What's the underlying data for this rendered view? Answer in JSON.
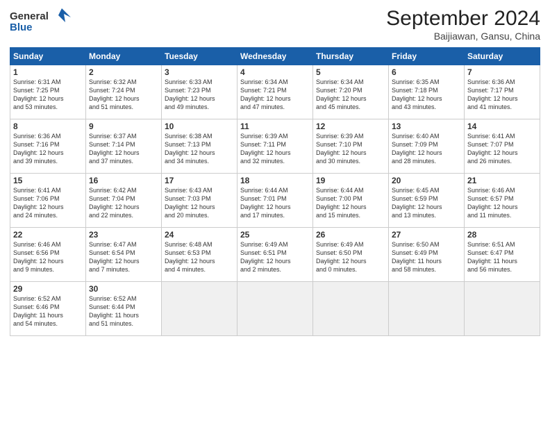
{
  "header": {
    "logo_general": "General",
    "logo_blue": "Blue",
    "month_title": "September 2024",
    "location": "Baijiawan, Gansu, China"
  },
  "weekdays": [
    "Sunday",
    "Monday",
    "Tuesday",
    "Wednesday",
    "Thursday",
    "Friday",
    "Saturday"
  ],
  "weeks": [
    [
      {
        "day": "1",
        "detail": "Sunrise: 6:31 AM\nSunset: 7:25 PM\nDaylight: 12 hours\nand 53 minutes."
      },
      {
        "day": "2",
        "detail": "Sunrise: 6:32 AM\nSunset: 7:24 PM\nDaylight: 12 hours\nand 51 minutes."
      },
      {
        "day": "3",
        "detail": "Sunrise: 6:33 AM\nSunset: 7:23 PM\nDaylight: 12 hours\nand 49 minutes."
      },
      {
        "day": "4",
        "detail": "Sunrise: 6:34 AM\nSunset: 7:21 PM\nDaylight: 12 hours\nand 47 minutes."
      },
      {
        "day": "5",
        "detail": "Sunrise: 6:34 AM\nSunset: 7:20 PM\nDaylight: 12 hours\nand 45 minutes."
      },
      {
        "day": "6",
        "detail": "Sunrise: 6:35 AM\nSunset: 7:18 PM\nDaylight: 12 hours\nand 43 minutes."
      },
      {
        "day": "7",
        "detail": "Sunrise: 6:36 AM\nSunset: 7:17 PM\nDaylight: 12 hours\nand 41 minutes."
      }
    ],
    [
      {
        "day": "8",
        "detail": "Sunrise: 6:36 AM\nSunset: 7:16 PM\nDaylight: 12 hours\nand 39 minutes."
      },
      {
        "day": "9",
        "detail": "Sunrise: 6:37 AM\nSunset: 7:14 PM\nDaylight: 12 hours\nand 37 minutes."
      },
      {
        "day": "10",
        "detail": "Sunrise: 6:38 AM\nSunset: 7:13 PM\nDaylight: 12 hours\nand 34 minutes."
      },
      {
        "day": "11",
        "detail": "Sunrise: 6:39 AM\nSunset: 7:11 PM\nDaylight: 12 hours\nand 32 minutes."
      },
      {
        "day": "12",
        "detail": "Sunrise: 6:39 AM\nSunset: 7:10 PM\nDaylight: 12 hours\nand 30 minutes."
      },
      {
        "day": "13",
        "detail": "Sunrise: 6:40 AM\nSunset: 7:09 PM\nDaylight: 12 hours\nand 28 minutes."
      },
      {
        "day": "14",
        "detail": "Sunrise: 6:41 AM\nSunset: 7:07 PM\nDaylight: 12 hours\nand 26 minutes."
      }
    ],
    [
      {
        "day": "15",
        "detail": "Sunrise: 6:41 AM\nSunset: 7:06 PM\nDaylight: 12 hours\nand 24 minutes."
      },
      {
        "day": "16",
        "detail": "Sunrise: 6:42 AM\nSunset: 7:04 PM\nDaylight: 12 hours\nand 22 minutes."
      },
      {
        "day": "17",
        "detail": "Sunrise: 6:43 AM\nSunset: 7:03 PM\nDaylight: 12 hours\nand 20 minutes."
      },
      {
        "day": "18",
        "detail": "Sunrise: 6:44 AM\nSunset: 7:01 PM\nDaylight: 12 hours\nand 17 minutes."
      },
      {
        "day": "19",
        "detail": "Sunrise: 6:44 AM\nSunset: 7:00 PM\nDaylight: 12 hours\nand 15 minutes."
      },
      {
        "day": "20",
        "detail": "Sunrise: 6:45 AM\nSunset: 6:59 PM\nDaylight: 12 hours\nand 13 minutes."
      },
      {
        "day": "21",
        "detail": "Sunrise: 6:46 AM\nSunset: 6:57 PM\nDaylight: 12 hours\nand 11 minutes."
      }
    ],
    [
      {
        "day": "22",
        "detail": "Sunrise: 6:46 AM\nSunset: 6:56 PM\nDaylight: 12 hours\nand 9 minutes."
      },
      {
        "day": "23",
        "detail": "Sunrise: 6:47 AM\nSunset: 6:54 PM\nDaylight: 12 hours\nand 7 minutes."
      },
      {
        "day": "24",
        "detail": "Sunrise: 6:48 AM\nSunset: 6:53 PM\nDaylight: 12 hours\nand 4 minutes."
      },
      {
        "day": "25",
        "detail": "Sunrise: 6:49 AM\nSunset: 6:51 PM\nDaylight: 12 hours\nand 2 minutes."
      },
      {
        "day": "26",
        "detail": "Sunrise: 6:49 AM\nSunset: 6:50 PM\nDaylight: 12 hours\nand 0 minutes."
      },
      {
        "day": "27",
        "detail": "Sunrise: 6:50 AM\nSunset: 6:49 PM\nDaylight: 11 hours\nand 58 minutes."
      },
      {
        "day": "28",
        "detail": "Sunrise: 6:51 AM\nSunset: 6:47 PM\nDaylight: 11 hours\nand 56 minutes."
      }
    ],
    [
      {
        "day": "29",
        "detail": "Sunrise: 6:52 AM\nSunset: 6:46 PM\nDaylight: 11 hours\nand 54 minutes."
      },
      {
        "day": "30",
        "detail": "Sunrise: 6:52 AM\nSunset: 6:44 PM\nDaylight: 11 hours\nand 51 minutes."
      },
      null,
      null,
      null,
      null,
      null
    ]
  ]
}
